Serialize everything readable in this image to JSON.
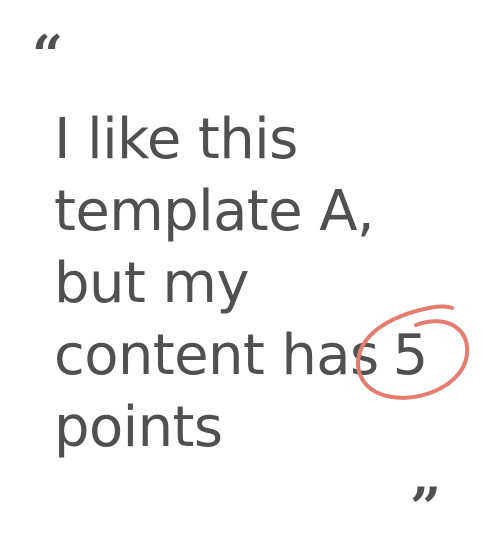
{
  "quote": {
    "open_mark": "“",
    "lines": [
      "I like this",
      "template A,",
      "but my",
      "content has",
      "points"
    ],
    "highlighted_number": "5",
    "close_mark": "”"
  },
  "colors": {
    "text": "#505050",
    "annotation": "#E47D70",
    "background": "#ffffff"
  },
  "icons": {
    "annotation": "hand-drawn-circle-icon"
  }
}
